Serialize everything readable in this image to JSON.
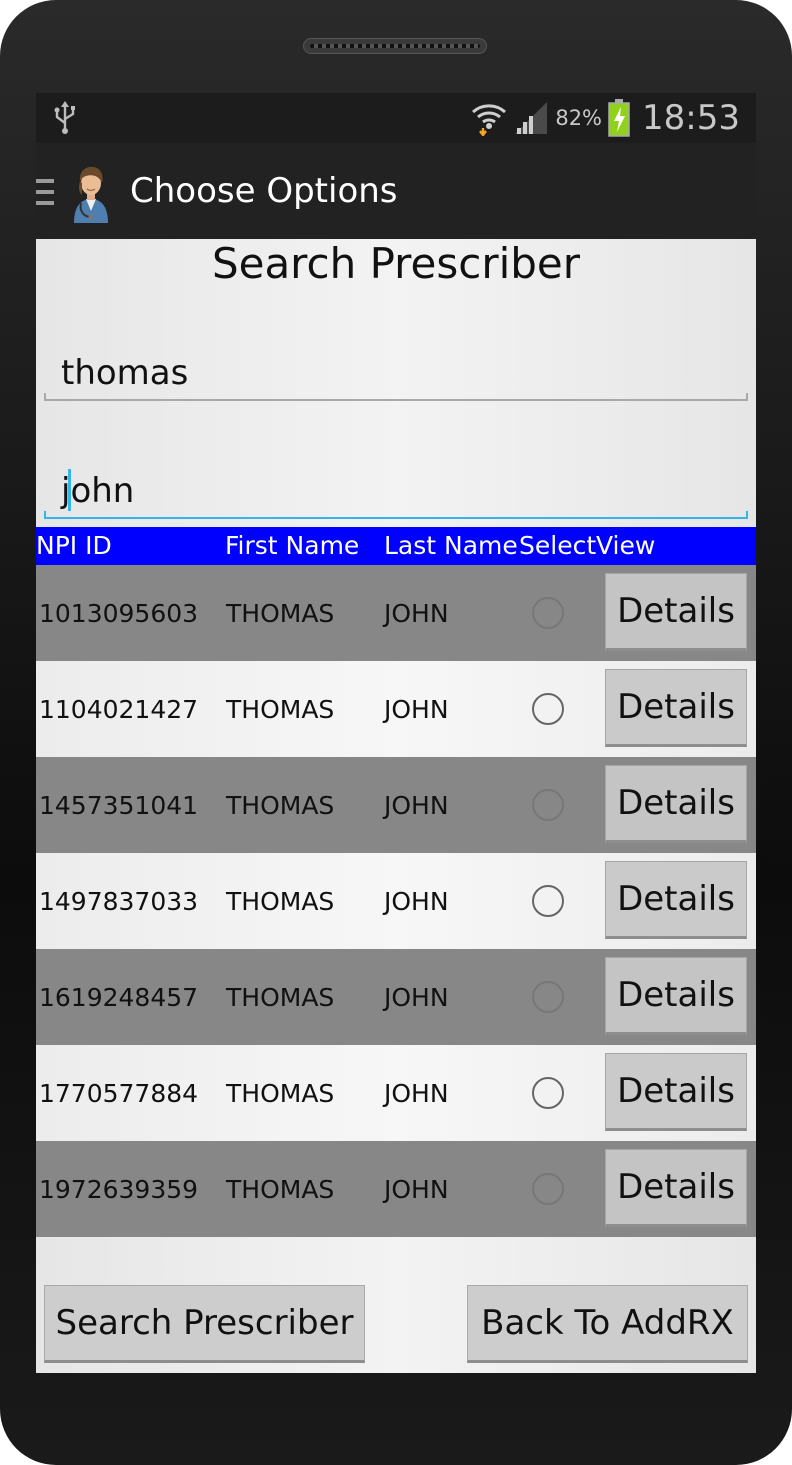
{
  "statusbar": {
    "battery_percent": "82%",
    "time": "18:53",
    "icons": [
      "usb-icon",
      "wifi-icon",
      "signal-icon",
      "battery-charging-icon"
    ]
  },
  "actionbar": {
    "title": "Choose Options",
    "icons": [
      "menu-icon",
      "doctor-avatar-icon"
    ]
  },
  "page": {
    "heading": "Search Prescriber"
  },
  "search": {
    "first_name_value": "thomas",
    "last_name_value": "john"
  },
  "table": {
    "headers": {
      "npi_id": "NPI ID",
      "first_name": "First Name",
      "last_name": "Last Name",
      "select": "Select",
      "view": "View"
    },
    "rows": [
      {
        "npi": "1013095603",
        "first": "THOMAS",
        "last": "JOHN",
        "details_label": "Details",
        "selected": false
      },
      {
        "npi": "1104021427",
        "first": "THOMAS",
        "last": "JOHN",
        "details_label": "Details",
        "selected": false
      },
      {
        "npi": "1457351041",
        "first": "THOMAS",
        "last": "JOHN",
        "details_label": "Details",
        "selected": false
      },
      {
        "npi": "1497837033",
        "first": "THOMAS",
        "last": "JOHN",
        "details_label": "Details",
        "selected": false
      },
      {
        "npi": "1619248457",
        "first": "THOMAS",
        "last": "JOHN",
        "details_label": "Details",
        "selected": false
      },
      {
        "npi": "1770577884",
        "first": "THOMAS",
        "last": "JOHN",
        "details_label": "Details",
        "selected": false
      },
      {
        "npi": "1972639359",
        "first": "THOMAS",
        "last": "JOHN",
        "details_label": "Details",
        "selected": false
      }
    ]
  },
  "buttons": {
    "search_label": "Search Prescriber",
    "back_label": "Back To AddRX"
  },
  "colors": {
    "header_bg": "#0000ff",
    "row_dark": "#878787",
    "focus_accent": "#33b5e5"
  }
}
